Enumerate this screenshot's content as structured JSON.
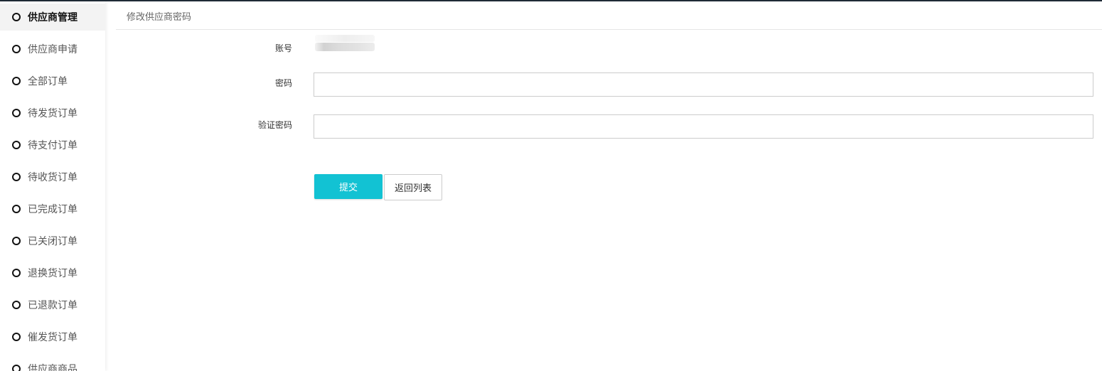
{
  "sidebar": {
    "items": [
      {
        "label": "供应商管理",
        "active": true
      },
      {
        "label": "供应商申请"
      },
      {
        "label": "全部订单"
      },
      {
        "label": "待发货订单"
      },
      {
        "label": "待支付订单"
      },
      {
        "label": "待收货订单"
      },
      {
        "label": "已完成订单"
      },
      {
        "label": "已关闭订单"
      },
      {
        "label": "退换货订单"
      },
      {
        "label": "已退款订单"
      },
      {
        "label": "催发货订单"
      },
      {
        "label": "供应商商品"
      }
    ]
  },
  "page": {
    "title": "修改供应商密码"
  },
  "form": {
    "account_label": "账号",
    "password_label": "密码",
    "password_value": "",
    "confirm_label": "验证密码",
    "confirm_value": "",
    "submit_label": "提交",
    "back_label": "返回列表"
  },
  "colors": {
    "accent": "#12c2d3",
    "active_item_bg": "#f3f3f3",
    "top_bar": "#1f2a36"
  }
}
